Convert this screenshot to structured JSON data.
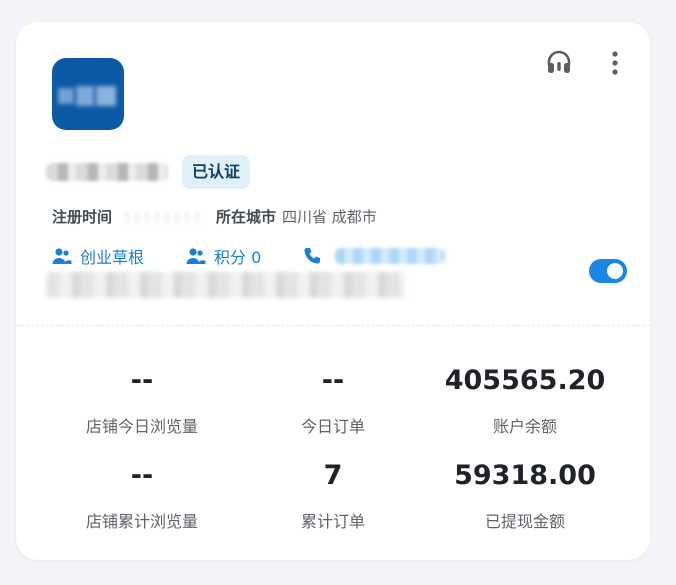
{
  "profile": {
    "verified_badge": "已认证",
    "registered_label": "注册时间",
    "city_label": "所在城市",
    "city_value": "四川省 成都市"
  },
  "links": {
    "tier": "创业草根",
    "points": "积分 0"
  },
  "stats": [
    {
      "value": "--",
      "label": "店铺今日浏览量"
    },
    {
      "value": "--",
      "label": "今日订单"
    },
    {
      "value": "405565.20",
      "label": "账户余额"
    },
    {
      "value": "--",
      "label": "店铺累计浏览量"
    },
    {
      "value": "7",
      "label": "累计订单"
    },
    {
      "value": "59318.00",
      "label": "已提现金额"
    }
  ],
  "colors": {
    "accent": "#1a7fd6",
    "badge_bg": "#dff0fb",
    "logo_bg": "#0c5aa6"
  },
  "icons": {
    "support": "headset-icon",
    "more": "more-vertical-icon",
    "tier": "users-icon",
    "points": "users-icon",
    "phone": "phone-icon"
  }
}
